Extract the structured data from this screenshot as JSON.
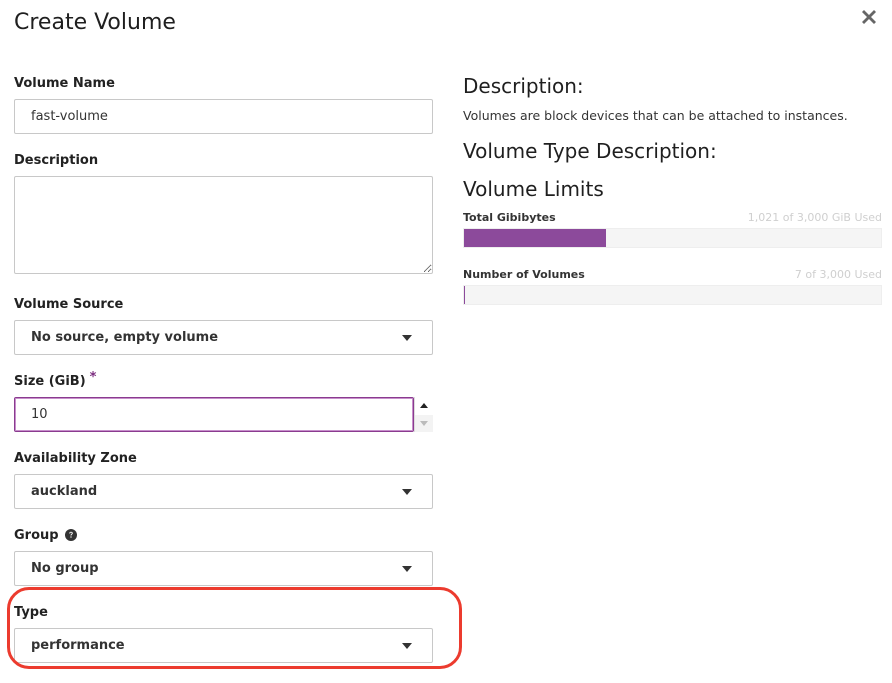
{
  "dialog": {
    "title": "Create Volume"
  },
  "form": {
    "volume_name": {
      "label": "Volume Name",
      "value": "fast-volume"
    },
    "description": {
      "label": "Description",
      "value": ""
    },
    "volume_source": {
      "label": "Volume Source",
      "value": "No source, empty volume"
    },
    "size": {
      "label": "Size (GiB)",
      "required_mark": "*",
      "value": "10"
    },
    "availability_zone": {
      "label": "Availability Zone",
      "value": "auckland"
    },
    "group": {
      "label": "Group",
      "value": "No group"
    },
    "type": {
      "label": "Type",
      "value": "performance"
    }
  },
  "info": {
    "description_heading": "Description:",
    "description_text": "Volumes are block devices that can be attached to instances.",
    "volume_type_heading": "Volume Type Description:",
    "limits_heading": "Volume Limits",
    "limits": [
      {
        "label": "Total Gibibytes",
        "value": "1,021 of 3,000 GiB Used",
        "fraction": 0.34
      },
      {
        "label": "Number of Volumes",
        "value": "7 of 3,000 Used",
        "fraction": 0.0023
      }
    ]
  },
  "colors": {
    "accent": "#8c4a9b",
    "highlight": "#ec3b2e"
  }
}
